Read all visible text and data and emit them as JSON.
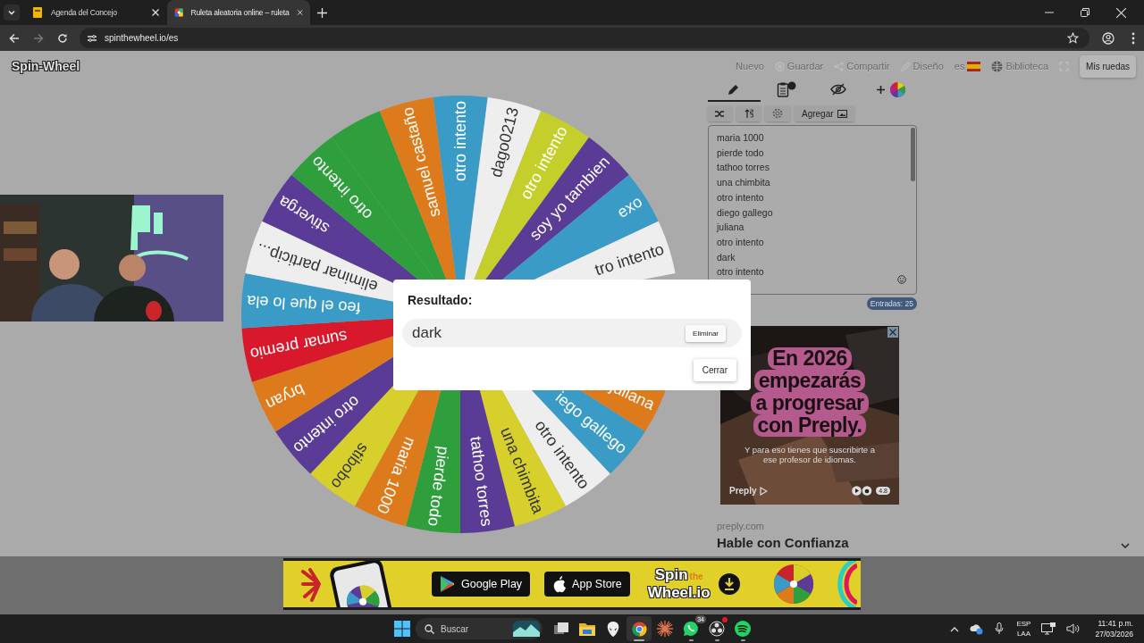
{
  "browser": {
    "tabs": [
      {
        "title": "Agenda del Concejo",
        "selected": false
      },
      {
        "title": "Ruleta aleatoria online – ruleta",
        "selected": true
      }
    ],
    "url": "spinthewheel.io/es"
  },
  "site": {
    "logo": "Spin-Wheel",
    "nav": [
      {
        "kind": "text",
        "label": "Nuevo"
      },
      {
        "kind": "save",
        "label": "Guardar"
      },
      {
        "kind": "share",
        "label": "Compartir"
      },
      {
        "kind": "design",
        "label": "Diseño"
      },
      {
        "kind": "language",
        "label": "es"
      },
      {
        "kind": "library",
        "label": "Biblioteca"
      },
      {
        "kind": "fullscreen"
      }
    ],
    "my_wheels": "Mis ruedas"
  },
  "wheel": {
    "segments": [
      {
        "kind": "shown",
        "label": "otro intento",
        "color": "#3a9cc6"
      },
      {
        "kind": "shown",
        "label": "dago0213",
        "color": "#eeeeee"
      },
      {
        "kind": "shown",
        "label": "otro intento",
        "color": "#c4cf2c"
      },
      {
        "kind": "shown",
        "label": "soy yo tambien",
        "color": "#5a3c96"
      },
      {
        "kind": "shown",
        "label": "exo",
        "color": "#3a9cc6"
      },
      {
        "kind": "shown",
        "label": "tro intento",
        "color": "#eeeeee"
      },
      {
        "kind": "covered"
      },
      {
        "kind": "covered"
      },
      {
        "kind": "shown",
        "label": "juliana",
        "color": "#dd7a1c"
      },
      {
        "kind": "shown",
        "label": "iego gallego",
        "color": "#3a9cc6"
      },
      {
        "kind": "shown",
        "label": "otro intento",
        "color": "#eeeeee"
      },
      {
        "kind": "shown",
        "label": "una chimbita",
        "color": "#d6cf2c"
      },
      {
        "kind": "shown",
        "label": "tathoo torres",
        "color": "#5a3c96"
      },
      {
        "kind": "shown",
        "label": "pierde todo",
        "color": "#2f9e3d"
      },
      {
        "kind": "shown",
        "label": "maria 1000",
        "color": "#dd7a1c"
      },
      {
        "kind": "shown",
        "label": "stibobo",
        "color": "#d6cf2c"
      },
      {
        "kind": "shown",
        "label": "otro intento",
        "color": "#5a3c96"
      },
      {
        "kind": "shown",
        "label": "bryan",
        "color": "#dd7a1c"
      },
      {
        "kind": "shown",
        "label": "sumar premio",
        "color": "#d7192b"
      },
      {
        "kind": "shown",
        "label": "feo el que lo ela",
        "color": "#3a9cc6"
      },
      {
        "kind": "shown",
        "label": "eliminar particip...",
        "color": "#eeeeee"
      },
      {
        "kind": "shown",
        "label": "stiverga",
        "color": "#5a3c96"
      },
      {
        "kind": "shown",
        "label": "otro intento",
        "color": "#2f9e3d"
      },
      {
        "kind": "shown",
        "color": "#2f9e3d"
      },
      {
        "kind": "shown",
        "label": "samuel castaño",
        "color": "#dd7a1c"
      }
    ]
  },
  "editor": {
    "tabs": [
      {
        "kind": "edit",
        "selected": true
      },
      {
        "kind": "results",
        "selected": false
      },
      {
        "kind": "hide",
        "selected": false
      },
      {
        "kind": "add",
        "selected": false
      }
    ],
    "tools": [
      {
        "kind": "shuffle"
      },
      {
        "kind": "sort"
      },
      {
        "kind": "settings"
      },
      {
        "kind": "add-image",
        "label": "Agregar"
      }
    ],
    "entries": [
      "maria 1000",
      "pierde todo",
      "tathoo torres",
      "una chimbita",
      "otro intento",
      "diego gallego",
      "juliana",
      "otro intento",
      "dark",
      "otro intento"
    ],
    "count": "Entradas: 25"
  },
  "dialog": {
    "title": "Resultado:",
    "result": "dark",
    "remove": "Eliminar",
    "close": "Cerrar"
  },
  "ad": {
    "headline": [
      "En 2026",
      "empezarás",
      "a progresar",
      "con Preply."
    ],
    "subtext": "Y para eso tienes que suscribirte a ese profesor de idiomas.",
    "brand": "Preply",
    "rating": "4.8",
    "domain": "preply.com",
    "title": "Hable con Confianza"
  },
  "banner": {
    "buttons": [
      {
        "kind": "google",
        "label": "Google Play"
      },
      {
        "kind": "apple",
        "label": "App Store"
      }
    ],
    "logo": [
      "Spin",
      "the",
      "Wheel.io"
    ]
  },
  "taskbar": {
    "search": "Buscar",
    "apps": [
      {
        "kind": "task-view",
        "selected": false,
        "running": false
      },
      {
        "kind": "folder",
        "selected": false,
        "running": false
      },
      {
        "kind": "alien",
        "selected": false,
        "running": false
      },
      {
        "kind": "chrome",
        "selected": true,
        "running": true
      },
      {
        "kind": "burst",
        "selected": false,
        "running": false
      },
      {
        "kind": "whatsapp",
        "selected": false,
        "running": true,
        "badge": "34"
      },
      {
        "kind": "obs",
        "selected": false,
        "running": true
      },
      {
        "kind": "spotify",
        "selected": false,
        "running": true
      }
    ],
    "language": [
      "ESP",
      "LAA"
    ],
    "time": "11:41 p.m.",
    "date": "27/03/2026"
  }
}
